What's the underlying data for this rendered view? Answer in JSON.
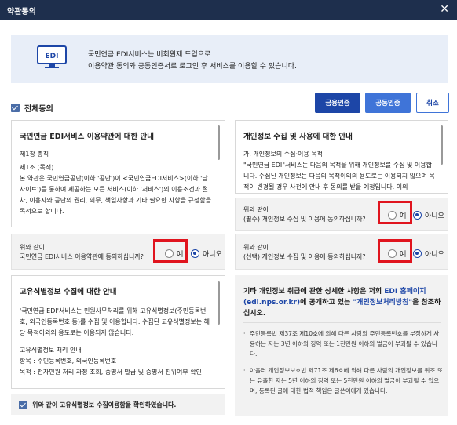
{
  "window": {
    "title": "약관동의",
    "close_glyph": "✕"
  },
  "notice": {
    "icon_text": "EDI",
    "line1": "국민연금 EDI서비스는 비회원제 도입으로",
    "line2": "이용약관 동의와 공동인증서로 로그인 후 서비스를 이용할 수 있습니다."
  },
  "all_agree": {
    "label": "전체동의",
    "checked": true
  },
  "buttons": {
    "financial_cert": "금융인증",
    "public_cert": "공동인증",
    "cancel": "취소"
  },
  "terms": {
    "title": "국민연금 EDI서비스 이용약관에 대한 안내",
    "chapter": "제1장 총칙",
    "article": "제1조 (목적)",
    "body": "본 약관은 국민연금공단(이하 '공단')이 <국민연금EDI서비스>(이하 '당 사이트')를 통하여 제공하는 모든 서비스(이하 '서비스')의 이용조건과 절차, 이용자와 공단의 권리, 의무, 책임사항과 기타 필요한 사항을 규정함을 목적으로 합니다.",
    "consent_q1": "위와 같이",
    "consent_q2": "국민연금 EDI서비스 이용약관에 동의하십니까?",
    "yes": "예",
    "no": "아니오"
  },
  "privacy": {
    "title": "개인정보 수집 및 사용에 대한 안내",
    "item": "가. 개인정보의 수집·이용 목적",
    "body": "\"국민연금 EDI\"서비스는 다음의 목적을 위해 개인정보를 수집 및 이용합니다. 수집된 개인정보는 다음의 목적이외의 용도로는 이용되지 않으며 목적이 변경될 경우 사전에 안내 후 동의를 받을 예정입니다. 이외",
    "required_q1": "위와 같이",
    "required_q2": "(필수) 개인정보 수집 및 이용에 동의하십니까?",
    "optional_q1": "위와 같이",
    "optional_q2": "(선택) 개인정보 수집 및 이용에 동의하십니까?",
    "yes": "예",
    "no": "아니오"
  },
  "unique_id": {
    "title": "고유식별정보 수집에 대한 안내",
    "body1": "'국민연금 EDI'서비스는 민원사무처리를 위해 고유식별정보(주민등록번호, 외국인등록번호 등)를 수집 및 이용합니다. 수집된 고유식별정보는 해당 목적이외의 용도로는 이용되지 않습니다.",
    "sub_title": "고유식별정보 처리 안내",
    "item1": "항목 : 주민등록번호, 외국인등록번호",
    "item2": "목적 : 전자민원 처리 과정 조회, 증명서 발급 및 증명서 진위여부 확인",
    "confirm_label": "위와 같이 고유식별정보 수집이용함을 확인하였습니다.",
    "confirm_checked": true
  },
  "info": {
    "lead_a": "기타 개인정보 취급에 관한 상세한 사항은 저희 ",
    "lead_link1": "EDI 홈페이지 (edi.nps.or.kr)",
    "lead_b": "에 공개하고 있는 ",
    "lead_link2": "\"개인정보처리방침\"",
    "lead_c": "을 참조하십시오.",
    "bullet1": "주민등록법 제37조 제10호에 의해 다른 사람의 주민등록번호를 부정하게 사용하는 자는 3년 이하의 징역 또는 1천만원 이하의 벌금이 부과될 수 있습니다.",
    "bullet2": "아울러 개인정보보호법 제71조 제6호에 의해 다른 사람의 개인정보를 위조 또는 유출한 자는 5년 이하의 징역 또는 5천만원 이하의 벌금이 부과될 수 있으며, 등록된 글에 대한 법적 책임은 글쓴이에게 있습니다."
  }
}
